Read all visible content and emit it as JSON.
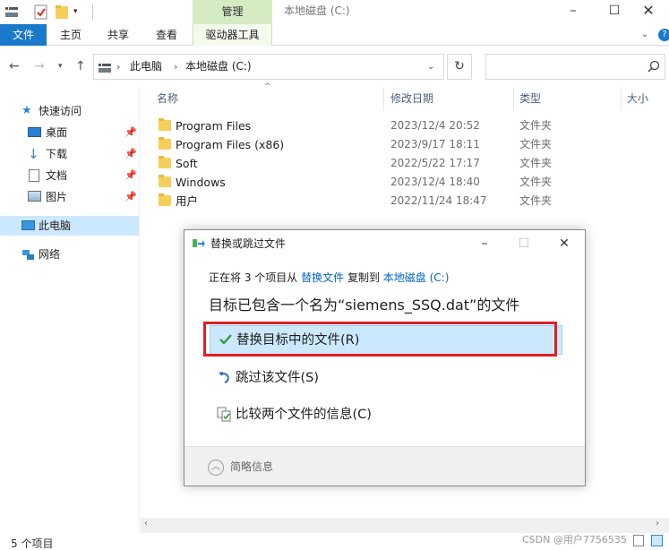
{
  "window": {
    "title": "本地磁盘 (C:)",
    "context_tab_group": "管理"
  },
  "ribbon": {
    "tabs": [
      "文件",
      "主页",
      "共享",
      "查看",
      "驱动器工具"
    ]
  },
  "address": {
    "crumbs": [
      "此电脑",
      "本地磁盘 (C:)"
    ]
  },
  "nav": {
    "quick_access": "快速访问",
    "pinned": [
      "桌面",
      "下载",
      "文档",
      "图片"
    ],
    "this_pc": "此电脑",
    "network": "网络"
  },
  "columns": {
    "name": "名称",
    "modified": "修改日期",
    "type": "类型",
    "size": "大小"
  },
  "files": [
    {
      "name": "Program Files",
      "date": "2023/12/4 20:52",
      "type": "文件夹"
    },
    {
      "name": "Program Files (x86)",
      "date": "2023/9/17 18:11",
      "type": "文件夹"
    },
    {
      "name": "Soft",
      "date": "2022/5/22 17:17",
      "type": "文件夹"
    },
    {
      "name": "Windows",
      "date": "2023/12/4 18:40",
      "type": "文件夹"
    },
    {
      "name": "用户",
      "date": "2022/11/24 18:47",
      "type": "文件夹"
    }
  ],
  "status": {
    "item_count": "5 个项目"
  },
  "dialog": {
    "title": "替换或跳过文件",
    "sub_prefix": "正在将 3 个项目从",
    "source": "替换文件",
    "sub_middle": "复制到",
    "destination": "本地磁盘 (C:)",
    "main": "目标已包含一个名为“siemens_SSQ.dat”的文件",
    "options": {
      "replace": "替换目标中的文件(R)",
      "skip": "跳过该文件(S)",
      "compare": "比较两个文件的信息(C)"
    },
    "details": "简略信息"
  },
  "watermark": "CSDN @用户7756535"
}
